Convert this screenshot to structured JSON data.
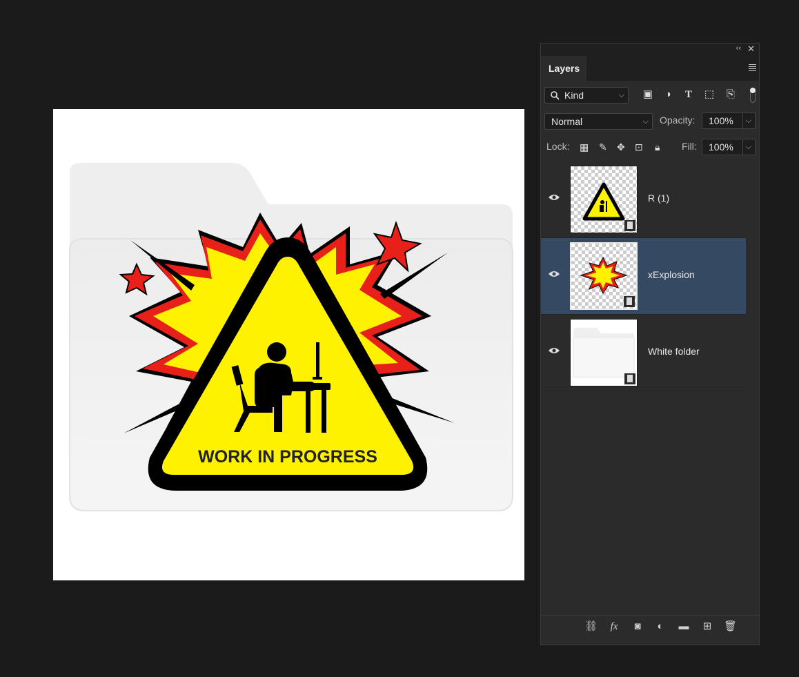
{
  "canvas": {
    "sign_text": "WORK IN PROGRESS"
  },
  "panel": {
    "tab_label": "Layers",
    "filter": {
      "selected": "Kind"
    },
    "blend_mode": {
      "selected": "Normal"
    },
    "opacity": {
      "label": "Opacity:",
      "value": "100%"
    },
    "lock": {
      "label": "Lock:"
    },
    "fill": {
      "label": "Fill:",
      "value": "100%"
    },
    "layers": [
      {
        "name": "R (1)",
        "visible": true,
        "selected": false
      },
      {
        "name": "xExplosion",
        "visible": true,
        "selected": true
      },
      {
        "name": "White folder",
        "visible": true,
        "selected": false
      }
    ]
  },
  "colors": {
    "background": "#1b1b1b",
    "panel": "#2b2b2b",
    "selected_row": "#354962",
    "sign_yellow": "#fff200",
    "burst_red": "#e8201a"
  }
}
